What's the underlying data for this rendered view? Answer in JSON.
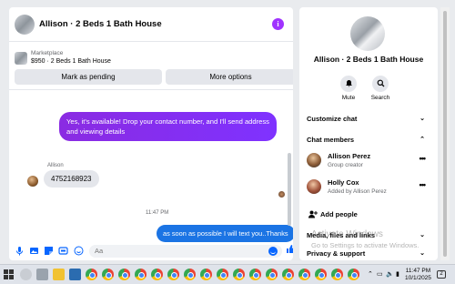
{
  "chat": {
    "title": "Allison · 2 Beds 1 Bath House",
    "info_icon": "i",
    "marketplace_label": "Marketplace",
    "listing": "$950 · 2 Beds 1 Bath House",
    "mark_pending": "Mark as pending",
    "more_options": "More options",
    "messages": [
      {
        "from": "me",
        "text": "Yes, it's available! Drop your contact number, and I'll send address and viewing details"
      },
      {
        "from": "Allison",
        "sender_label": "Allison",
        "text": "4752168923"
      },
      {
        "from": "me",
        "text": "as soon as possible I will text you..Thanks"
      }
    ],
    "timestamp": "11:47 PM",
    "composer_placeholder": "Aa",
    "accent_color": "#0866ff",
    "outgoing_bubble_color": "#1b74e4",
    "highlight_bubble_color": "#8a2be2"
  },
  "info": {
    "title": "Allison · 2 Beds 1 Bath House",
    "mute_label": "Mute",
    "search_label": "Search",
    "customize_chat": "Customize chat",
    "chat_members": "Chat members",
    "members": [
      {
        "name": "Allison Perez",
        "role": "Group creator"
      },
      {
        "name": "Holly Cox",
        "role": "Added by Allison Perez"
      }
    ],
    "add_people": "Add people",
    "media_files": "Media, files and links",
    "privacy_support": "Privacy & support"
  },
  "watermark": {
    "line1": "Activate Windows",
    "line2": "Go to Settings to activate Windows."
  },
  "taskbar": {
    "time": "11:47 PM",
    "date": "10/1/2025",
    "notification_count": "2"
  }
}
